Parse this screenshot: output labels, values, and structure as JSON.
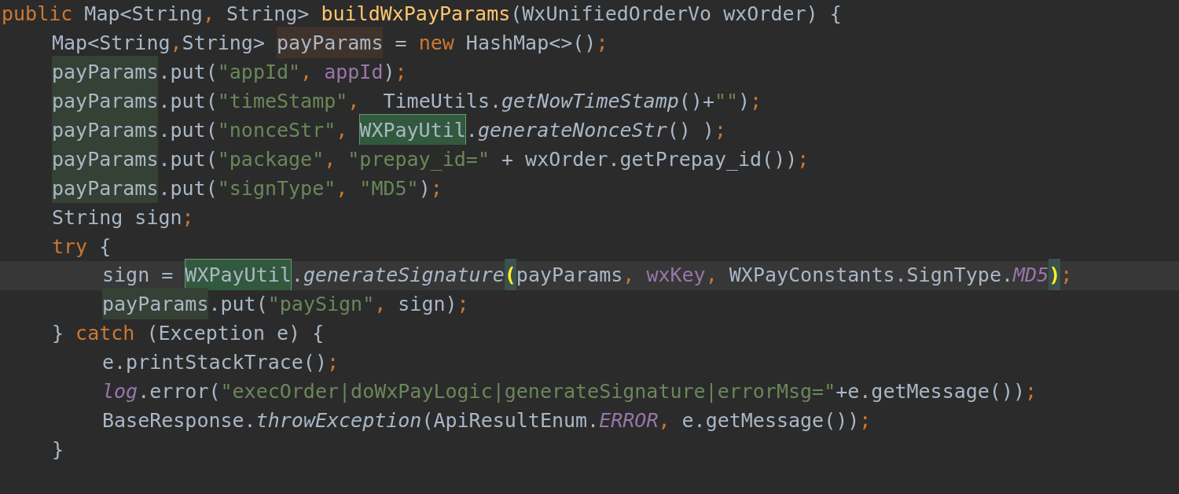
{
  "editor": {
    "lines": [
      {
        "current": false,
        "tokens": [
          {
            "text": "public",
            "kind": "keyword"
          },
          {
            "text": " Map<String",
            "kind": "plain"
          },
          {
            "text": ",",
            "kind": "keyword"
          },
          {
            "text": " String> ",
            "kind": "plain"
          },
          {
            "text": "buildWxPayParams",
            "kind": "declaration"
          },
          {
            "text": "(WxUnifiedOrderVo wxOrder) {",
            "kind": "plain"
          }
        ],
        "children": [
          {
            "current": false,
            "tokens": [
              {
                "text": "Map<String",
                "kind": "plain"
              },
              {
                "text": ",",
                "kind": "keyword"
              },
              {
                "text": "String> ",
                "kind": "plain"
              },
              {
                "text": "payParams",
                "kind": "write"
              },
              {
                "text": " = ",
                "kind": "plain"
              },
              {
                "text": "new",
                "kind": "keyword"
              },
              {
                "text": " HashMap<>()",
                "kind": "plain"
              },
              {
                "text": ";",
                "kind": "keyword"
              }
            ]
          },
          {
            "current": false,
            "tokens": [
              {
                "text": "payParams",
                "kind": "read"
              },
              {
                "text": ".put(",
                "kind": "plain"
              },
              {
                "text": "\"appId\"",
                "kind": "string"
              },
              {
                "text": ", ",
                "kind": "keyword"
              },
              {
                "text": "appId",
                "kind": "field"
              },
              {
                "text": ")",
                "kind": "plain"
              },
              {
                "text": ";",
                "kind": "keyword"
              }
            ]
          },
          {
            "current": false,
            "tokens": [
              {
                "text": "payParams",
                "kind": "read"
              },
              {
                "text": ".put(",
                "kind": "plain"
              },
              {
                "text": "\"timeStamp\"",
                "kind": "string"
              },
              {
                "text": ",",
                "kind": "keyword"
              },
              {
                "text": "  TimeUtils.",
                "kind": "plain"
              },
              {
                "text": "getNowTimeStamp",
                "kind": "static-method"
              },
              {
                "text": "()+",
                "kind": "plain"
              },
              {
                "text": "\"\"",
                "kind": "string"
              },
              {
                "text": ")",
                "kind": "plain"
              },
              {
                "text": ";",
                "kind": "keyword"
              }
            ]
          },
          {
            "current": false,
            "tokens": [
              {
                "text": "payParams",
                "kind": "read"
              },
              {
                "text": ".put(",
                "kind": "plain"
              },
              {
                "text": "\"nonceStr\"",
                "kind": "string"
              },
              {
                "text": ", ",
                "kind": "keyword"
              },
              {
                "text": "WXPayUtil",
                "kind": "match"
              },
              {
                "text": ".",
                "kind": "plain"
              },
              {
                "text": "generateNonceStr",
                "kind": "static-method"
              },
              {
                "text": "() )",
                "kind": "plain"
              },
              {
                "text": ";",
                "kind": "keyword"
              }
            ]
          },
          {
            "current": false,
            "tokens": [
              {
                "text": "payParams",
                "kind": "read"
              },
              {
                "text": ".put(",
                "kind": "plain"
              },
              {
                "text": "\"package\"",
                "kind": "string"
              },
              {
                "text": ", ",
                "kind": "keyword"
              },
              {
                "text": "\"prepay_id=\"",
                "kind": "string"
              },
              {
                "text": " + wxOrder.getPrepay_id())",
                "kind": "plain"
              },
              {
                "text": ";",
                "kind": "keyword"
              }
            ]
          },
          {
            "current": false,
            "tokens": [
              {
                "text": "payParams",
                "kind": "read"
              },
              {
                "text": ".put(",
                "kind": "plain"
              },
              {
                "text": "\"signType\"",
                "kind": "string"
              },
              {
                "text": ", ",
                "kind": "keyword"
              },
              {
                "text": "\"MD5\"",
                "kind": "string"
              },
              {
                "text": ")",
                "kind": "plain"
              },
              {
                "text": ";",
                "kind": "keyword"
              }
            ]
          },
          {
            "current": false,
            "tokens": [
              {
                "text": "String sign",
                "kind": "plain"
              },
              {
                "text": ";",
                "kind": "keyword"
              }
            ]
          },
          {
            "current": false,
            "tokens": [
              {
                "text": "try",
                "kind": "keyword"
              },
              {
                "text": " {",
                "kind": "plain"
              }
            ],
            "children": [
              {
                "current": true,
                "tokens": [
                  {
                    "text": "sign = ",
                    "kind": "plain"
                  },
                  {
                    "text": "WXPayUtil",
                    "kind": "match"
                  },
                  {
                    "text": ".",
                    "kind": "plain"
                  },
                  {
                    "text": "generateSignature",
                    "kind": "static-method"
                  },
                  {
                    "text": "(",
                    "kind": "brace"
                  },
                  {
                    "text": "payParams",
                    "kind": "plain"
                  },
                  {
                    "text": ", ",
                    "kind": "keyword"
                  },
                  {
                    "text": "wxKey",
                    "kind": "field"
                  },
                  {
                    "text": ",",
                    "kind": "keyword"
                  },
                  {
                    "text": " WXPayConstants.SignType.",
                    "kind": "plain"
                  },
                  {
                    "text": "MD5",
                    "kind": "static-field"
                  },
                  {
                    "text": ")",
                    "kind": "brace"
                  },
                  {
                    "text": ";",
                    "kind": "keyword"
                  }
                ]
              },
              {
                "current": false,
                "tokens": [
                  {
                    "text": "payParams",
                    "kind": "read"
                  },
                  {
                    "text": ".put(",
                    "kind": "plain"
                  },
                  {
                    "text": "\"paySign\"",
                    "kind": "string"
                  },
                  {
                    "text": ",",
                    "kind": "keyword"
                  },
                  {
                    "text": " sign)",
                    "kind": "plain"
                  },
                  {
                    "text": ";",
                    "kind": "keyword"
                  }
                ]
              }
            ]
          },
          {
            "current": false,
            "tokens": [
              {
                "text": "} ",
                "kind": "plain"
              },
              {
                "text": "catch",
                "kind": "keyword"
              },
              {
                "text": " (Exception e) {",
                "kind": "plain"
              }
            ],
            "children": [
              {
                "current": false,
                "tokens": [
                  {
                    "text": "e.printStackTrace()",
                    "kind": "plain"
                  },
                  {
                    "text": ";",
                    "kind": "keyword"
                  }
                ]
              },
              {
                "current": false,
                "tokens": [
                  {
                    "text": "log",
                    "kind": "static-field"
                  },
                  {
                    "text": ".error(",
                    "kind": "plain"
                  },
                  {
                    "text": "\"execOrder|doWxPayLogic|generateSignature|errorMsg=\"",
                    "kind": "string"
                  },
                  {
                    "text": "+e.getMessage())",
                    "kind": "plain"
                  },
                  {
                    "text": ";",
                    "kind": "keyword"
                  }
                ]
              },
              {
                "current": false,
                "tokens": [
                  {
                    "text": "BaseResponse.",
                    "kind": "plain"
                  },
                  {
                    "text": "throwException",
                    "kind": "static-method"
                  },
                  {
                    "text": "(ApiResultEnum.",
                    "kind": "plain"
                  },
                  {
                    "text": "ERROR",
                    "kind": "static-field"
                  },
                  {
                    "text": ",",
                    "kind": "keyword"
                  },
                  {
                    "text": " e.getMessage())",
                    "kind": "plain"
                  },
                  {
                    "text": ";",
                    "kind": "keyword"
                  }
                ]
              }
            ]
          },
          {
            "current": false,
            "tokens": [
              {
                "text": "}",
                "kind": "plain"
              }
            ]
          }
        ]
      }
    ]
  }
}
